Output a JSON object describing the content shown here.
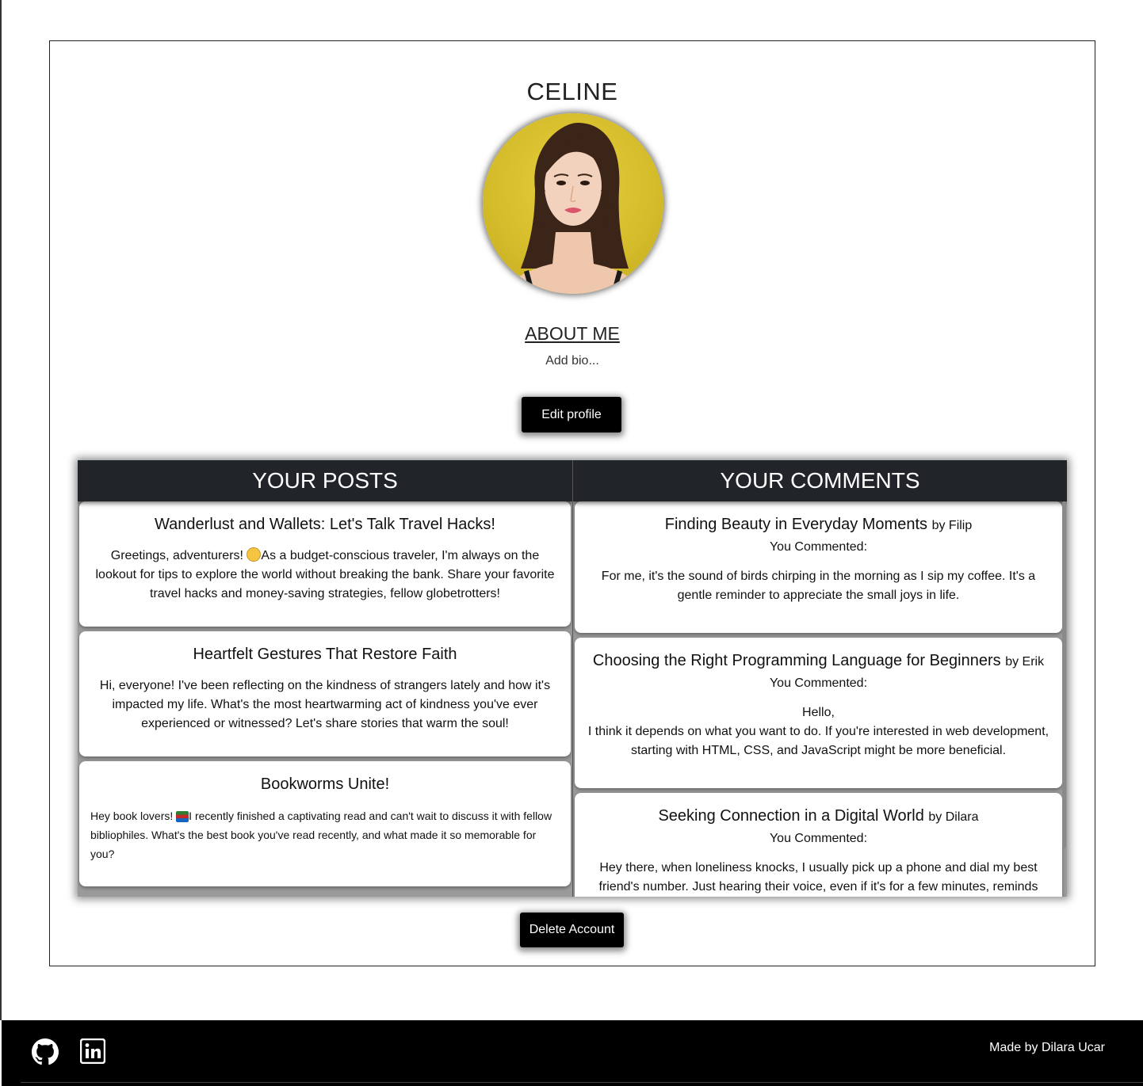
{
  "profile": {
    "username": "CELINE",
    "about_title": "ABOUT ME",
    "bio": "Add bio...",
    "edit_button": "Edit profile",
    "delete_button": "Delete Account"
  },
  "posts_panel": {
    "title": "YOUR POSTS",
    "posts": [
      {
        "title": "Wanderlust and Wallets: Let's Talk Travel Hacks!",
        "text_before_emoji": "Greetings, adventurers! ",
        "text_after_emoji": "As a budget-conscious traveler, I'm always on the lookout for tips to explore the world without breaking the bank. Share your favorite travel hacks and money-saving strategies, fellow globetrotters!"
      },
      {
        "title": "Heartfelt Gestures That Restore Faith",
        "text": "Hi, everyone! I've been reflecting on the kindness of strangers lately and how it's impacted my life. What's the most heartwarming act of kindness you've ever experienced or witnessed? Let's share stories that warm the soul!"
      },
      {
        "title": "Bookworms Unite!",
        "text_before_emoji": "Hey book lovers! ",
        "text_after_emoji": "I recently finished a captivating read and can't wait to discuss it with fellow bibliophiles. What's the best book you've read recently, and what made it so memorable for you?"
      }
    ]
  },
  "comments_panel": {
    "title": "YOUR COMMENTS",
    "comments": [
      {
        "post_title": "Finding Beauty in Everyday Moments",
        "author": "by Filip",
        "label": "You Commented:",
        "text": "For me, it's the sound of birds chirping in the morning as I sip my coffee. It's a gentle reminder to appreciate the small joys in life."
      },
      {
        "post_title": "Choosing the Right Programming Language for Beginners",
        "author": "by Erik",
        "label": "You Commented:",
        "greeting": "Hello,",
        "text": "I think it depends on what you want to do. If you're interested in web development, starting with HTML, CSS, and JavaScript might be more beneficial."
      },
      {
        "post_title": "Seeking Connection in a Digital World",
        "author": "by Dilara",
        "label": "You Commented:",
        "text": "Hey there, when loneliness knocks, I usually pick up a phone and dial my best friend's number. Just hearing their voice, even if it's for a few minutes, reminds"
      }
    ]
  },
  "footer": {
    "credit": "Made by Dilara Ucar",
    "icons": [
      "github-icon",
      "linkedin-icon"
    ]
  },
  "colors": {
    "panel_header": "#212529",
    "button": "#000000",
    "footer": "#000000",
    "avatar_background": "#d4bb2a"
  }
}
